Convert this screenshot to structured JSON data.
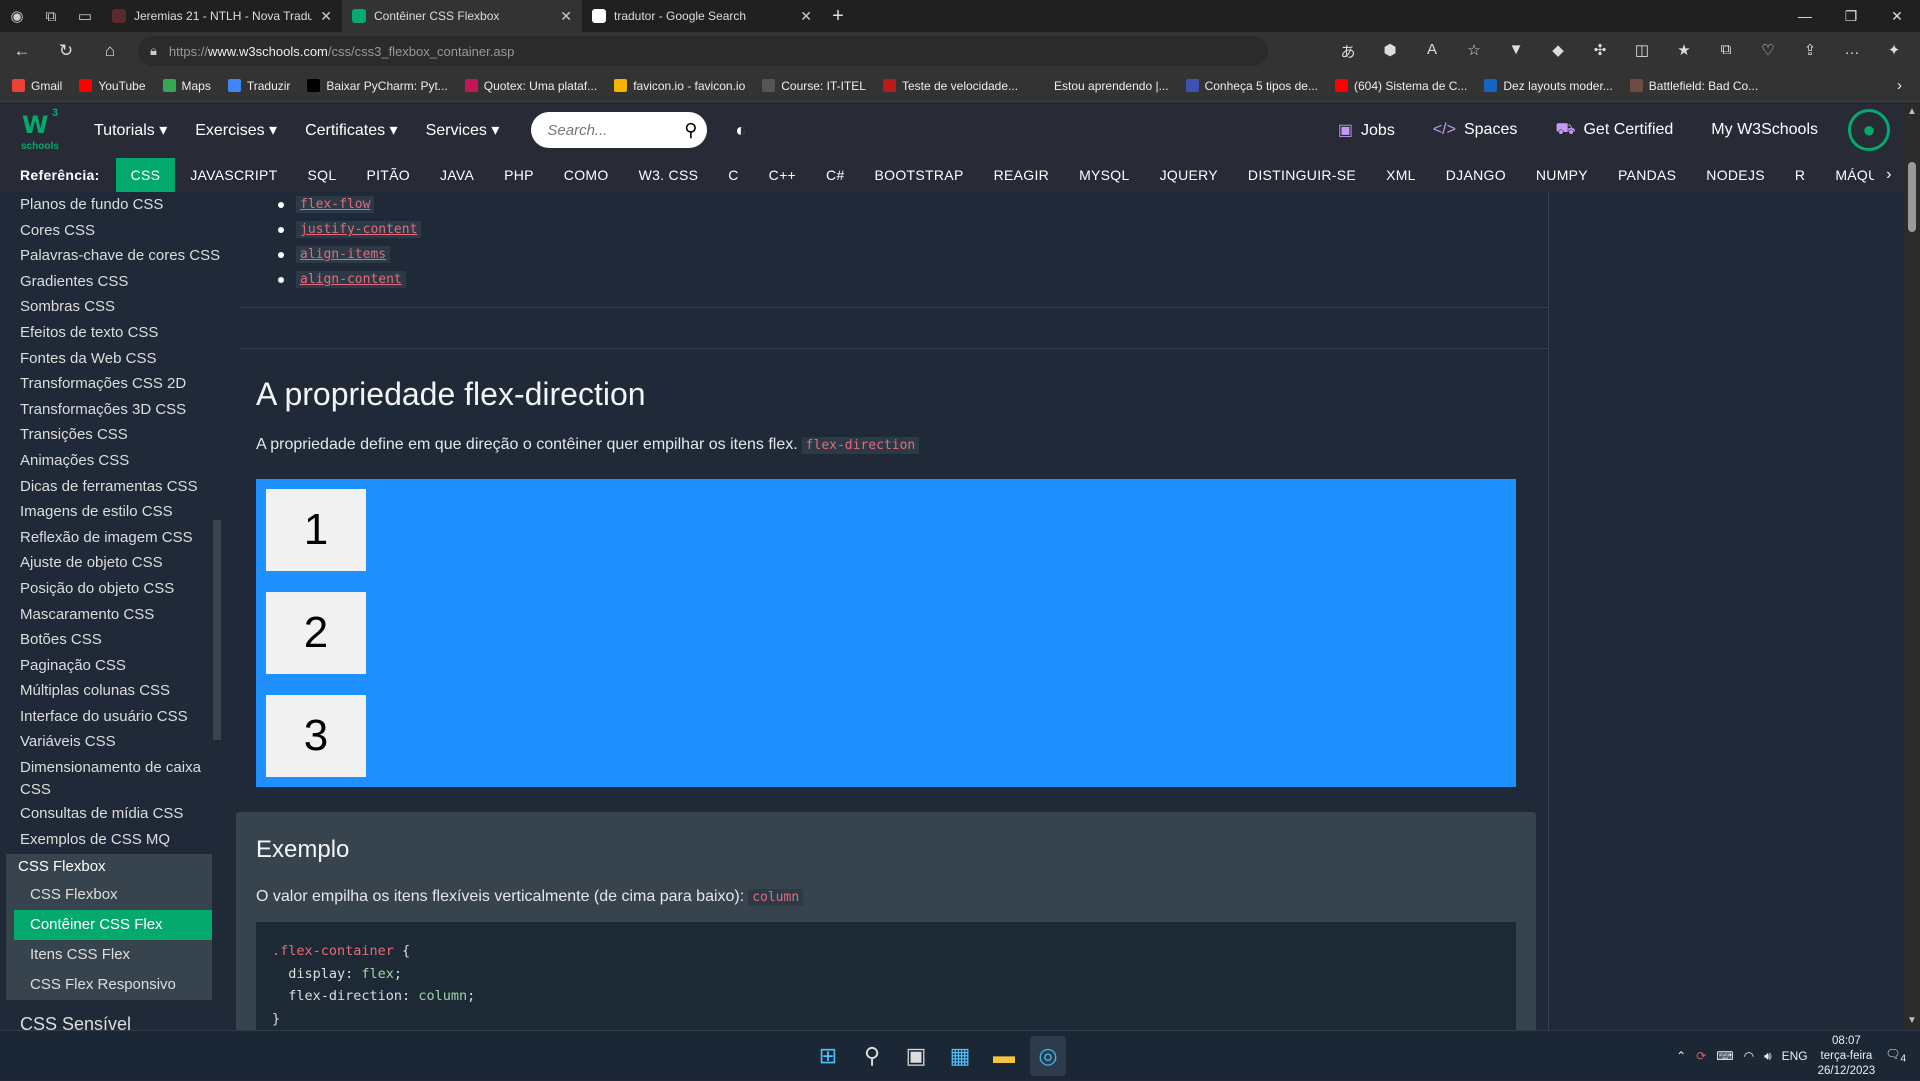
{
  "browser": {
    "tabs": [
      {
        "title": "Jeremias 21 - NTLH - Nova Tradu",
        "favicon_color": "#5a2a2a",
        "active": false
      },
      {
        "title": "Contêiner CSS Flexbox",
        "favicon_color": "#04aa6d",
        "active": true
      },
      {
        "title": "tradutor - Google Search",
        "favicon_color": "#ffffff",
        "active": false
      }
    ],
    "url_prefix": "https://",
    "url_domain": "www.w3schools.com",
    "url_path": "/css/css3_flexbox_container.asp",
    "bookmarks": [
      {
        "label": "Gmail",
        "color": "#ea4335"
      },
      {
        "label": "YouTube",
        "color": "#ff0000"
      },
      {
        "label": "Maps",
        "color": "#34a853"
      },
      {
        "label": "Traduzir",
        "color": "#4285f4"
      },
      {
        "label": "Baixar PyCharm: Pyt...",
        "color": "#000000"
      },
      {
        "label": "Quotex: Uma plataf...",
        "color": "#c2185b"
      },
      {
        "label": "favicon.io - favicon.io",
        "color": "#f4b400"
      },
      {
        "label": "Course: IT-ITEL",
        "color": "#555555"
      },
      {
        "label": "Teste de velocidade...",
        "color": "#b71c1c"
      },
      {
        "label": "Estou aprendendo |...",
        "color": "#333333"
      },
      {
        "label": "Conheça 5 tipos de...",
        "color": "#3f51b5"
      },
      {
        "label": "(604) Sistema de C...",
        "color": "#ff0000"
      },
      {
        "label": "Dez layouts moder...",
        "color": "#1565c0"
      },
      {
        "label": "Battlefield: Bad Co...",
        "color": "#6d4c41"
      }
    ]
  },
  "w3": {
    "logo_text": "W",
    "logo_sup": "3",
    "logo_sub": "schools",
    "menu": [
      "Tutorials ▾",
      "Exercises ▾",
      "Certificates ▾",
      "Services ▾"
    ],
    "search_placeholder": "Search...",
    "right_links": {
      "jobs": "Jobs",
      "spaces": "Spaces",
      "certified": "Get Certified",
      "my": "My W3Schools"
    },
    "ref_label": "Referência:",
    "ref_items": [
      "CSS",
      "JAVASCRIPT",
      "SQL",
      "PITÃO",
      "JAVA",
      "PHP",
      "COMO",
      "W3. CSS",
      "C",
      "C++",
      "C#",
      "BOOTSTRAP",
      "REAGIR",
      "MYSQL",
      "JQUERY",
      "DISTINGUIR-SE",
      "XML",
      "DJANGO",
      "NUMPY",
      "PANDAS",
      "NODEJS",
      "R",
      "MÁQUI"
    ],
    "accent": "#04aa6d"
  },
  "sidebar": {
    "items": [
      "Planos de fundo CSS",
      "Cores CSS",
      "Palavras-chave de cores CSS",
      "Gradientes CSS",
      "Sombras CSS",
      "Efeitos de texto CSS",
      "Fontes da Web CSS",
      "Transformações CSS 2D",
      "Transformações 3D CSS",
      "Transições CSS",
      "Animações CSS",
      "Dicas de ferramentas CSS",
      "Imagens de estilo CSS",
      "Reflexão de imagem CSS",
      "Ajuste de objeto CSS",
      "Posição do objeto CSS",
      "Mascaramento CSS",
      "Botões CSS",
      "Paginação CSS",
      "Múltiplas colunas CSS",
      "Interface do usuário CSS",
      "Variáveis CSS"
    ],
    "two_line_item": "Dimensionamento de caixa CSS",
    "after_items": [
      "Consultas de mídia CSS",
      "Exemplos de CSS MQ"
    ],
    "flexbox_header": "CSS Flexbox",
    "flexbox_sub": [
      "CSS Flexbox",
      "Contêiner CSS Flex",
      "Itens CSS Flex",
      "CSS Flex Responsivo"
    ],
    "cut_text": "CSS Sensível"
  },
  "main": {
    "bullets": [
      "flex-flow",
      "justify-content",
      "align-items",
      "align-content"
    ],
    "heading": "A propriedade flex-direction",
    "para_text": "A propriedade define em que direção o contêiner quer empilhar os itens flex.",
    "para_code": "flex-direction",
    "flex_items": [
      "1",
      "2",
      "3"
    ],
    "demo_color": "#1e90ff",
    "example_title": "Exemplo",
    "example_text": "O valor empilha os itens flexíveis verticalmente (de cima para baixo):",
    "example_code": "column",
    "code_lines": {
      "l1_sel": ".flex-container",
      "l1_rest": " {",
      "l2_prop": "  display: ",
      "l2_val": "flex",
      "l2_end": ";",
      "l3_prop": "  flex-direction: ",
      "l3_val": "column",
      "l3_end": ";",
      "l4": "}"
    }
  },
  "taskbar": {
    "lang": "ENG",
    "time": "08:07",
    "day": "terça-feira",
    "date": "26/12/2023",
    "notif_count": "4"
  }
}
